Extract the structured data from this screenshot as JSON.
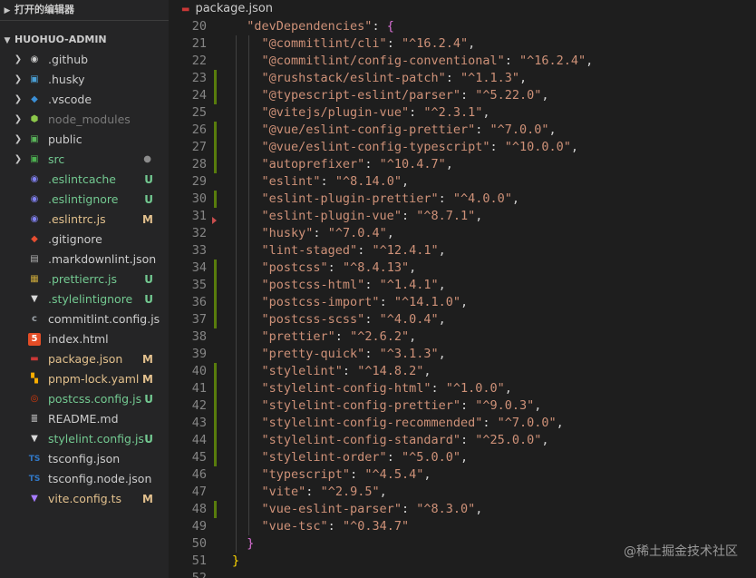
{
  "sidebar": {
    "open_editors_label": "打开的编辑器",
    "project_label": "HUOHUO-ADMIN",
    "items": [
      {
        "name": ".github",
        "type": "folder",
        "icon": "github-folder-icon",
        "color": "#cccccc",
        "badge": ""
      },
      {
        "name": ".husky",
        "type": "folder",
        "icon": "husky-folder-icon",
        "color": "#cccccc",
        "badge": ""
      },
      {
        "name": ".vscode",
        "type": "folder",
        "icon": "vscode-folder-icon",
        "color": "#cccccc",
        "badge": ""
      },
      {
        "name": "node_modules",
        "type": "folder",
        "icon": "node-folder-icon",
        "color": "dim",
        "badge": ""
      },
      {
        "name": "public",
        "type": "folder",
        "icon": "public-folder-icon",
        "color": "#cccccc",
        "badge": ""
      },
      {
        "name": "src",
        "type": "folder",
        "icon": "src-folder-icon",
        "color": "green",
        "badge": "●"
      },
      {
        "name": ".eslintcache",
        "type": "file",
        "icon": "eslint-icon",
        "color": "green",
        "badge": "U"
      },
      {
        "name": ".eslintignore",
        "type": "file",
        "icon": "eslint-icon",
        "color": "green",
        "badge": "U"
      },
      {
        "name": ".eslintrc.js",
        "type": "file",
        "icon": "eslint-icon",
        "color": "yellow",
        "badge": "M"
      },
      {
        "name": ".gitignore",
        "type": "file",
        "icon": "git-icon",
        "color": "#cccccc",
        "badge": ""
      },
      {
        "name": ".markdownlint.json",
        "type": "file",
        "icon": "markdownlint-icon",
        "color": "#cccccc",
        "badge": ""
      },
      {
        "name": ".prettierrc.js",
        "type": "file",
        "icon": "prettier-icon",
        "color": "green",
        "badge": "U"
      },
      {
        "name": ".stylelintignore",
        "type": "file",
        "icon": "stylelint-icon",
        "color": "green",
        "badge": "U"
      },
      {
        "name": "commitlint.config.js",
        "type": "file",
        "icon": "commitlint-icon",
        "color": "#cccccc",
        "badge": ""
      },
      {
        "name": "index.html",
        "type": "file",
        "icon": "html-icon",
        "color": "#cccccc",
        "badge": ""
      },
      {
        "name": "package.json",
        "type": "file",
        "icon": "npm-icon",
        "color": "yellow",
        "badge": "M"
      },
      {
        "name": "pnpm-lock.yaml",
        "type": "file",
        "icon": "pnpm-icon",
        "color": "yellow",
        "badge": "M"
      },
      {
        "name": "postcss.config.js",
        "type": "file",
        "icon": "postcss-icon",
        "color": "green",
        "badge": "U"
      },
      {
        "name": "README.md",
        "type": "file",
        "icon": "readme-icon",
        "color": "#cccccc",
        "badge": ""
      },
      {
        "name": "stylelint.config.js",
        "type": "file",
        "icon": "stylelint-icon",
        "color": "green",
        "badge": "U"
      },
      {
        "name": "tsconfig.json",
        "type": "file",
        "icon": "ts-icon",
        "color": "#cccccc",
        "badge": ""
      },
      {
        "name": "tsconfig.node.json",
        "type": "file",
        "icon": "ts-icon",
        "color": "#cccccc",
        "badge": ""
      },
      {
        "name": "vite.config.ts",
        "type": "file",
        "icon": "vite-icon",
        "color": "yellow",
        "badge": "M"
      }
    ]
  },
  "editor": {
    "tab_label": "package.json",
    "lines": [
      {
        "n": "20",
        "text": "  \"devDependencies\": {",
        "mark": ""
      },
      {
        "n": "21",
        "text": "    \"@commitlint/cli\": \"^16.2.4\",",
        "mark": ""
      },
      {
        "n": "22",
        "text": "    \"@commitlint/config-conventional\": \"^16.2.4\",",
        "mark": ""
      },
      {
        "n": "23",
        "text": "    \"@rushstack/eslint-patch\": \"^1.1.3\",",
        "mark": "add"
      },
      {
        "n": "24",
        "text": "    \"@typescript-eslint/parser\": \"^5.22.0\",",
        "mark": "add"
      },
      {
        "n": "25",
        "text": "    \"@vitejs/plugin-vue\": \"^2.3.1\",",
        "mark": ""
      },
      {
        "n": "26",
        "text": "    \"@vue/eslint-config-prettier\": \"^7.0.0\",",
        "mark": "add"
      },
      {
        "n": "27",
        "text": "    \"@vue/eslint-config-typescript\": \"^10.0.0\",",
        "mark": "add"
      },
      {
        "n": "28",
        "text": "    \"autoprefixer\": \"^10.4.7\",",
        "mark": "add"
      },
      {
        "n": "29",
        "text": "    \"eslint\": \"^8.14.0\",",
        "mark": ""
      },
      {
        "n": "30",
        "text": "    \"eslint-plugin-prettier\": \"^4.0.0\",",
        "mark": "add"
      },
      {
        "n": "31",
        "text": "    \"eslint-plugin-vue\": \"^8.7.1\",",
        "mark": "del"
      },
      {
        "n": "32",
        "text": "    \"husky\": \"^7.0.4\",",
        "mark": ""
      },
      {
        "n": "33",
        "text": "    \"lint-staged\": \"^12.4.1\",",
        "mark": ""
      },
      {
        "n": "34",
        "text": "    \"postcss\": \"^8.4.13\",",
        "mark": "add"
      },
      {
        "n": "35",
        "text": "    \"postcss-html\": \"^1.4.1\",",
        "mark": "add"
      },
      {
        "n": "36",
        "text": "    \"postcss-import\": \"^14.1.0\",",
        "mark": "add"
      },
      {
        "n": "37",
        "text": "    \"postcss-scss\": \"^4.0.4\",",
        "mark": "add"
      },
      {
        "n": "38",
        "text": "    \"prettier\": \"^2.6.2\",",
        "mark": ""
      },
      {
        "n": "39",
        "text": "    \"pretty-quick\": \"^3.1.3\",",
        "mark": ""
      },
      {
        "n": "40",
        "text": "    \"stylelint\": \"^14.8.2\",",
        "mark": "add"
      },
      {
        "n": "41",
        "text": "    \"stylelint-config-html\": \"^1.0.0\",",
        "mark": "add"
      },
      {
        "n": "42",
        "text": "    \"stylelint-config-prettier\": \"^9.0.3\",",
        "mark": "add"
      },
      {
        "n": "43",
        "text": "    \"stylelint-config-recommended\": \"^7.0.0\",",
        "mark": "add"
      },
      {
        "n": "44",
        "text": "    \"stylelint-config-standard\": \"^25.0.0\",",
        "mark": "add"
      },
      {
        "n": "45",
        "text": "    \"stylelint-order\": \"^5.0.0\",",
        "mark": "add"
      },
      {
        "n": "46",
        "text": "    \"typescript\": \"^4.5.4\",",
        "mark": ""
      },
      {
        "n": "47",
        "text": "    \"vite\": \"^2.9.5\",",
        "mark": ""
      },
      {
        "n": "48",
        "text": "    \"vue-eslint-parser\": \"^8.3.0\",",
        "mark": "add"
      },
      {
        "n": "49",
        "text": "    \"vue-tsc\": \"^0.34.7\"",
        "mark": ""
      },
      {
        "n": "50",
        "text": "  }",
        "mark": ""
      },
      {
        "n": "51",
        "text": "}",
        "mark": ""
      },
      {
        "n": "52",
        "text": "",
        "mark": ""
      }
    ]
  },
  "watermark": "@稀土掘金技术社区",
  "colors": {
    "added": "#587c0c",
    "untracked": "#73c991",
    "modified": "#e2c08d",
    "string": "#ce9178"
  }
}
